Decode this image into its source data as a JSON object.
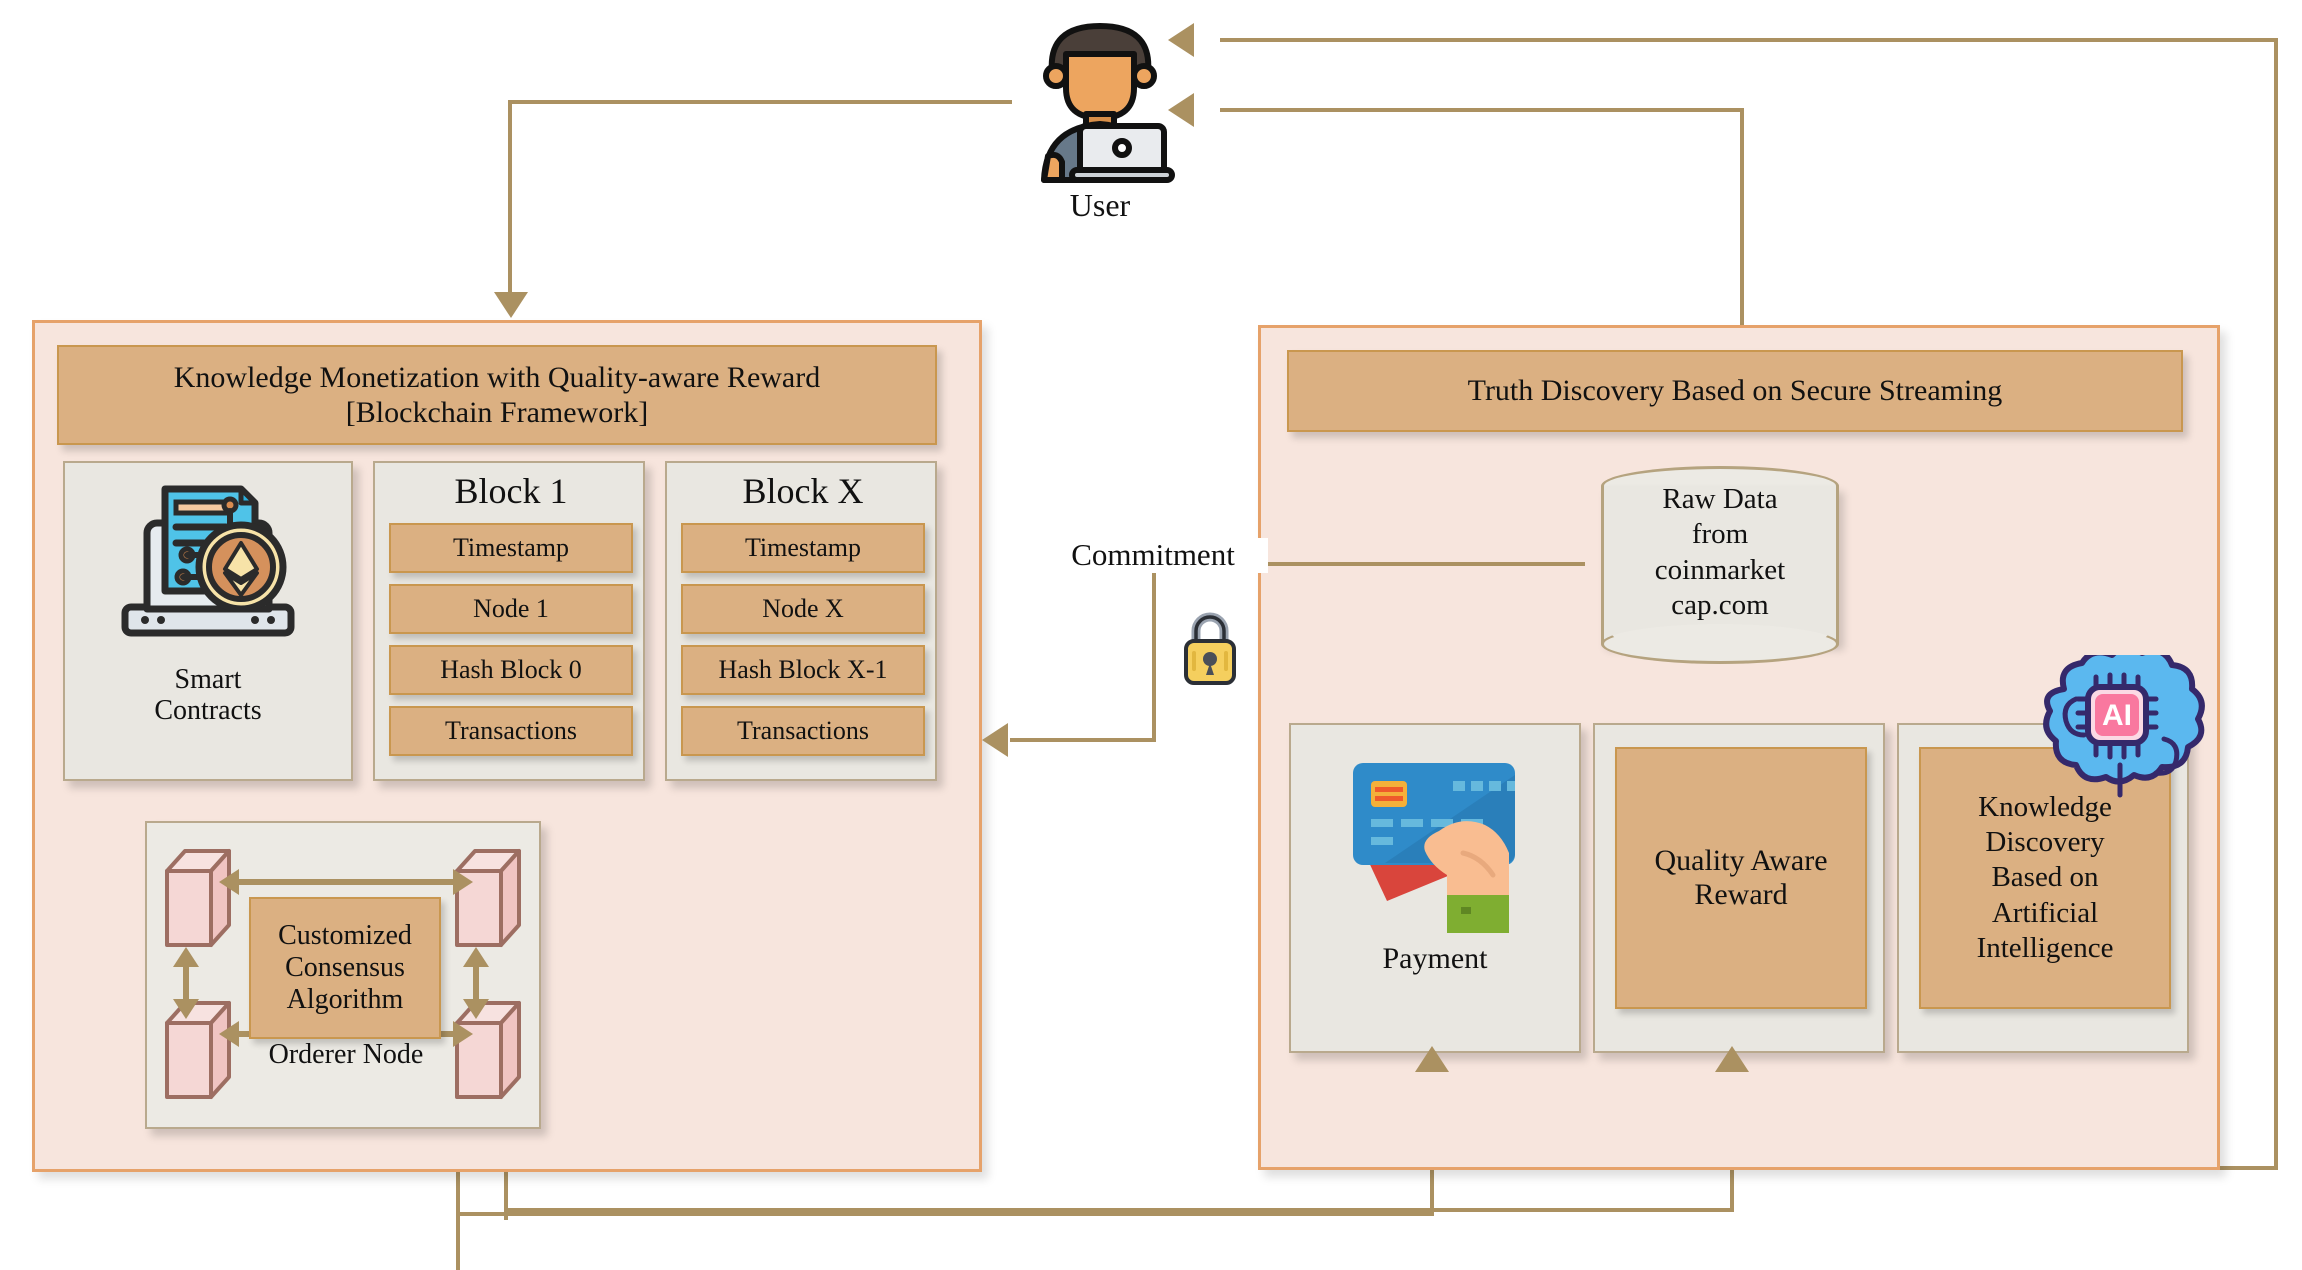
{
  "actor": {
    "label": "User",
    "icon": "user-with-laptop-icon"
  },
  "left_panel": {
    "title": "Knowledge Monetization with Quality-aware Reward\n[Blockchain Framework]",
    "title_line1": "Knowledge Monetization with Quality-aware Reward",
    "title_line2": "[Blockchain Framework]",
    "smart_contracts": {
      "label": "Smart\nContracts",
      "label_line1": "Smart",
      "label_line2": "Contracts",
      "icon": "smart-contract-laptop-ethereum-icon"
    },
    "blocks": [
      {
        "title": "Block 1",
        "fields": [
          "Timestamp",
          "Node 1",
          "Hash Block 0",
          "Transactions"
        ]
      },
      {
        "title": "Block X",
        "fields": [
          "Timestamp",
          "Node X",
          "Hash Block X-1",
          "Transactions"
        ]
      }
    ],
    "consensus": {
      "center_label": "Customized\nConsensus\nAlgorithm",
      "center_line1": "Customized",
      "center_line2": "Consensus",
      "center_line3": "Algorithm",
      "bottom_label": "Orderer Node",
      "node_icon": "cube-node-icon",
      "node_count": 4
    }
  },
  "right_panel": {
    "title": "Truth Discovery Based on Secure Streaming",
    "datastore": {
      "label": "Raw Data from coinmarketcap.com",
      "line1": "Raw Data",
      "line2": "from",
      "line3": "coinmarket",
      "line4": "cap.com",
      "icon": "database-cylinder-icon"
    },
    "cards": [
      {
        "label": "Payment",
        "icon": "credit-card-hand-icon",
        "kind": "icon-card"
      },
      {
        "label": "Quality Aware Reward",
        "line1": "Quality Aware",
        "line2": "Reward",
        "kind": "tan-card"
      },
      {
        "label": "Knowledge Discovery Based on Artificial Intelligence",
        "line1": "Knowledge",
        "line2": "Discovery",
        "line3": "Based on",
        "line4": "Artificial",
        "line5": "Intelligence",
        "kind": "tan-card",
        "badge_icon": "ai-brain-chip-icon"
      }
    ]
  },
  "connectors": {
    "commitment_label": "Commitment",
    "lock_icon": "padlock-icon"
  },
  "colors": {
    "panel_fill": "#f7e5dd",
    "panel_border": "#e6a26a",
    "tan": "#dbb082",
    "tan_border": "#c9974f",
    "card_fill": "#e9e7e1",
    "card_border": "#b9a98d",
    "connector": "#ab9161",
    "cube_face": "#f0cfcd",
    "cube_edge": "#9d6e62",
    "ai_blue": "#5bb8ef",
    "ai_pink": "#f9789f",
    "lock_yellow": "#f5cf5e"
  }
}
